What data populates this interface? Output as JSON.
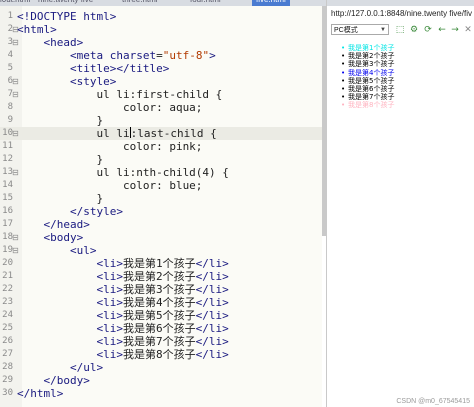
{
  "tabs": [
    "i0ut.html",
    "nine.twenty five",
    "three.html",
    "four.html",
    "five.html"
  ],
  "editor": {
    "lines": [
      {
        "n": "1",
        "fold": "",
        "segs": [
          {
            "t": "<!DOCTYPE html>",
            "c": "t"
          }
        ]
      },
      {
        "n": "2",
        "fold": "⊟",
        "segs": [
          {
            "t": "<html>",
            "c": "t"
          }
        ]
      },
      {
        "n": "3",
        "fold": "⊟",
        "segs": [
          {
            "t": "    "
          },
          {
            "t": "<head>",
            "c": "t"
          }
        ]
      },
      {
        "n": "4",
        "fold": "",
        "segs": [
          {
            "t": "        "
          },
          {
            "t": "<meta ",
            "c": "t"
          },
          {
            "t": "charset",
            "c": "t"
          },
          {
            "t": "=",
            "c": "p"
          },
          {
            "t": "\"utf-8\"",
            "c": "s"
          },
          {
            "t": ">",
            "c": "t"
          }
        ]
      },
      {
        "n": "5",
        "fold": "",
        "segs": [
          {
            "t": "        "
          },
          {
            "t": "<title></title>",
            "c": "t"
          }
        ]
      },
      {
        "n": "6",
        "fold": "⊟",
        "segs": [
          {
            "t": "        "
          },
          {
            "t": "<style>",
            "c": "t"
          }
        ]
      },
      {
        "n": "7",
        "fold": "⊟",
        "segs": [
          {
            "t": "            ul li:first-child {",
            "c": "p"
          }
        ]
      },
      {
        "n": "8",
        "fold": "",
        "segs": [
          {
            "t": "                color: aqua;",
            "c": "p"
          }
        ]
      },
      {
        "n": "9",
        "fold": "",
        "segs": [
          {
            "t": "            }",
            "c": "p"
          }
        ]
      },
      {
        "n": "10",
        "fold": "⊟",
        "hl": true,
        "segs": [
          {
            "t": "            ul li",
            "c": "p"
          },
          {
            "cursor": true
          },
          {
            "t": ":last-child {",
            "c": "p"
          }
        ]
      },
      {
        "n": "11",
        "fold": "",
        "segs": [
          {
            "t": "                color: pink;",
            "c": "p"
          }
        ]
      },
      {
        "n": "12",
        "fold": "",
        "segs": [
          {
            "t": "            }",
            "c": "p"
          }
        ]
      },
      {
        "n": "13",
        "fold": "⊟",
        "segs": [
          {
            "t": "            ul li:nth-child(4) {",
            "c": "p"
          }
        ]
      },
      {
        "n": "14",
        "fold": "",
        "segs": [
          {
            "t": "                color: blue;",
            "c": "p"
          }
        ]
      },
      {
        "n": "15",
        "fold": "",
        "segs": [
          {
            "t": "            }",
            "c": "p"
          }
        ]
      },
      {
        "n": "16",
        "fold": "",
        "segs": [
          {
            "t": "        "
          },
          {
            "t": "</style>",
            "c": "t"
          }
        ]
      },
      {
        "n": "17",
        "fold": "",
        "segs": [
          {
            "t": "    "
          },
          {
            "t": "</head>",
            "c": "t"
          }
        ]
      },
      {
        "n": "18",
        "fold": "⊟",
        "segs": [
          {
            "t": "    "
          },
          {
            "t": "<body>",
            "c": "t"
          }
        ]
      },
      {
        "n": "19",
        "fold": "⊟",
        "segs": [
          {
            "t": "        "
          },
          {
            "t": "<ul>",
            "c": "t"
          }
        ]
      },
      {
        "n": "20",
        "fold": "",
        "segs": [
          {
            "t": "            "
          },
          {
            "t": "<li>",
            "c": "t"
          },
          {
            "t": "我是第1个孩子",
            "c": "p"
          },
          {
            "t": "</li>",
            "c": "t"
          }
        ]
      },
      {
        "n": "21",
        "fold": "",
        "segs": [
          {
            "t": "            "
          },
          {
            "t": "<li>",
            "c": "t"
          },
          {
            "t": "我是第2个孩子",
            "c": "p"
          },
          {
            "t": "</li>",
            "c": "t"
          }
        ]
      },
      {
        "n": "22",
        "fold": "",
        "segs": [
          {
            "t": "            "
          },
          {
            "t": "<li>",
            "c": "t"
          },
          {
            "t": "我是第3个孩子",
            "c": "p"
          },
          {
            "t": "</li>",
            "c": "t"
          }
        ]
      },
      {
        "n": "23",
        "fold": "",
        "segs": [
          {
            "t": "            "
          },
          {
            "t": "<li>",
            "c": "t"
          },
          {
            "t": "我是第4个孩子",
            "c": "p"
          },
          {
            "t": "</li>",
            "c": "t"
          }
        ]
      },
      {
        "n": "24",
        "fold": "",
        "segs": [
          {
            "t": "            "
          },
          {
            "t": "<li>",
            "c": "t"
          },
          {
            "t": "我是第5个孩子",
            "c": "p"
          },
          {
            "t": "</li>",
            "c": "t"
          }
        ]
      },
      {
        "n": "25",
        "fold": "",
        "segs": [
          {
            "t": "            "
          },
          {
            "t": "<li>",
            "c": "t"
          },
          {
            "t": "我是第6个孩子",
            "c": "p"
          },
          {
            "t": "</li>",
            "c": "t"
          }
        ]
      },
      {
        "n": "26",
        "fold": "",
        "segs": [
          {
            "t": "            "
          },
          {
            "t": "<li>",
            "c": "t"
          },
          {
            "t": "我是第7个孩子",
            "c": "p"
          },
          {
            "t": "</li>",
            "c": "t"
          }
        ]
      },
      {
        "n": "27",
        "fold": "",
        "segs": [
          {
            "t": "            "
          },
          {
            "t": "<li>",
            "c": "t"
          },
          {
            "t": "我是第8个孩子",
            "c": "p"
          },
          {
            "t": "</li>",
            "c": "t"
          }
        ]
      },
      {
        "n": "28",
        "fold": "",
        "segs": [
          {
            "t": "        "
          },
          {
            "t": "</ul>",
            "c": "t"
          }
        ]
      },
      {
        "n": "29",
        "fold": "",
        "segs": [
          {
            "t": "    "
          },
          {
            "t": "</body>",
            "c": "t"
          }
        ]
      },
      {
        "n": "30",
        "fold": "",
        "segs": [
          {
            "t": "</html>",
            "c": "t"
          }
        ]
      }
    ]
  },
  "browser": {
    "url": "http://127.0.0.1:8848/nine.twenty five/five1.",
    "mode": "PC模式",
    "toolbar_icons": [
      "screenshot-icon",
      "settings-icon",
      "refresh-icon",
      "back-icon",
      "forward-icon",
      "close-icon"
    ],
    "items": [
      {
        "text": "我是第1个孩子",
        "color": "#00e5e5"
      },
      {
        "text": "我是第2个孩子",
        "color": "#000000"
      },
      {
        "text": "我是第3个孩子",
        "color": "#000000"
      },
      {
        "text": "我是第4个孩子",
        "color": "#0000ee"
      },
      {
        "text": "我是第5个孩子",
        "color": "#000000"
      },
      {
        "text": "我是第6个孩子",
        "color": "#000000"
      },
      {
        "text": "我是第7个孩子",
        "color": "#000000"
      },
      {
        "text": "我是第8个孩子",
        "color": "#ffb3c0"
      }
    ]
  },
  "watermark": "CSDN @m0_67545415"
}
